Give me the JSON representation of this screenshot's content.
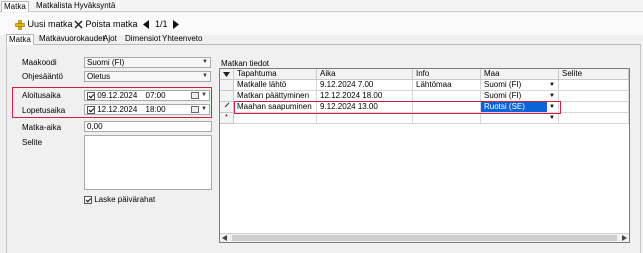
{
  "top_tabs": [
    {
      "label": "Matka"
    },
    {
      "label": "Matkalista"
    },
    {
      "label": "Hyväksyntä"
    }
  ],
  "toolbar": {
    "new_label": "Uusi matka",
    "delete_label": "Poista matka",
    "page_indicator": "1/1"
  },
  "sub_tabs": [
    {
      "label": "Matka"
    },
    {
      "label": "Matkavuorokaudet"
    },
    {
      "label": "Ajot"
    },
    {
      "label": "Dimensiot"
    },
    {
      "label": "Yhteenveto"
    }
  ],
  "form": {
    "country_label": "Maakoodi",
    "country_value": "Suomi (FI)",
    "rule_label": "Ohjesääntö",
    "rule_value": "Oletus",
    "start_label": "Aloitusaika",
    "start_date": "09.12.2024",
    "start_time": "07:00",
    "end_label": "Lopetusaika",
    "end_date": "12.12.2024",
    "end_time": "18:00",
    "duration_label": "Matka-aika",
    "duration_value": "0,00",
    "description_label": "Selite",
    "description_value": "",
    "allowance_label": "Laske päivärahat"
  },
  "grid": {
    "title": "Matkan tiedot",
    "columns": [
      "Tapahtuma",
      "Aika",
      "Info",
      "Maa",
      "Selite"
    ],
    "rows": [
      {
        "event": "Matkalle lähtö",
        "time": "9.12.2024 7.00",
        "info": "Lähtömaa",
        "country": "Suomi (FI)",
        "desc": ""
      },
      {
        "event": "Matkan päättyminen",
        "time": "12.12.2024 18.00",
        "info": "",
        "country": "Suomi (FI)",
        "desc": ""
      },
      {
        "event": "Maahan saapuminen",
        "time": "9.12.2024 13.00",
        "info": "",
        "country": "Ruotsi (SE)",
        "desc": ""
      }
    ]
  },
  "colors": {
    "highlight_red": "#d21f3c",
    "selection_blue": "#0a64d8"
  }
}
